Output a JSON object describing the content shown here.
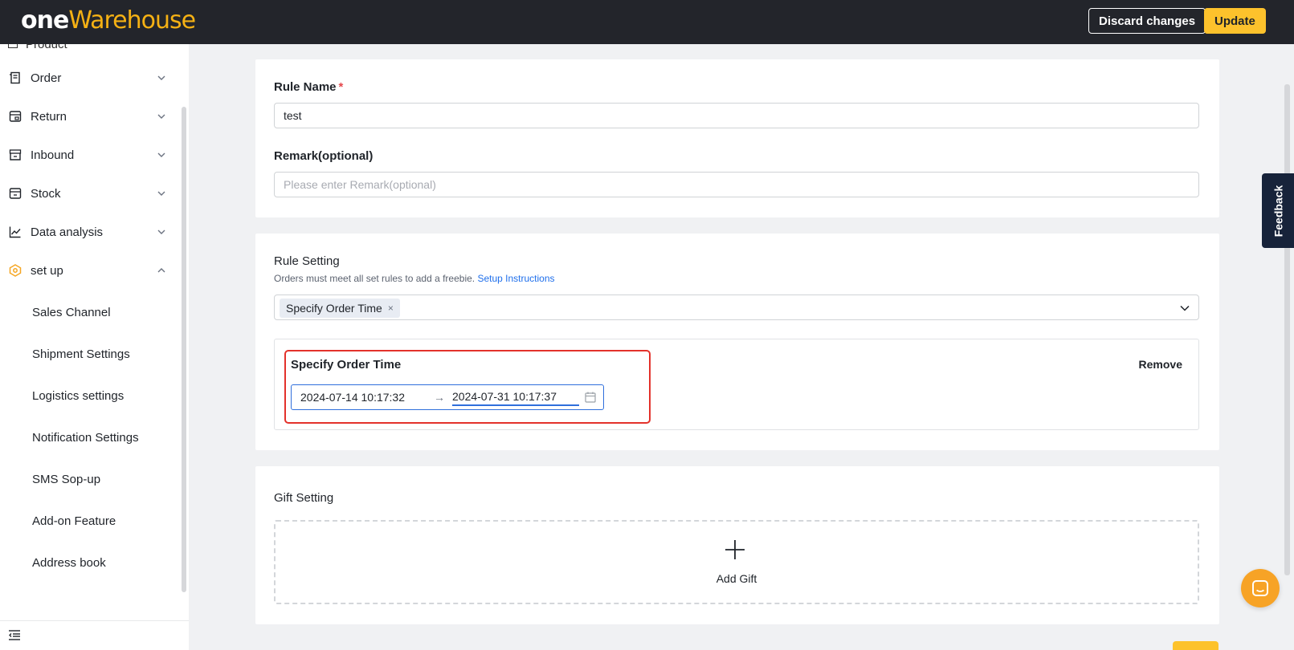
{
  "header": {
    "logo_one": "one",
    "logo_warehouse": "Warehouse",
    "discard_label": "Discard changes",
    "update_label": "Update"
  },
  "sidebar": {
    "partial_item": "Product",
    "items": [
      {
        "label": "Order",
        "icon": "order-icon",
        "expanded": false
      },
      {
        "label": "Return",
        "icon": "return-icon",
        "expanded": false
      },
      {
        "label": "Inbound",
        "icon": "inbound-icon",
        "expanded": false
      },
      {
        "label": "Stock",
        "icon": "stock-icon",
        "expanded": false
      },
      {
        "label": "Data analysis",
        "icon": "data-analysis-icon",
        "expanded": false
      },
      {
        "label": "set up",
        "icon": "setup-icon",
        "expanded": true
      }
    ],
    "sub_items": [
      "Sales Channel",
      "Shipment Settings",
      "Logistics settings",
      "Notification Settings",
      "SMS Sop-up",
      "Add-on Feature",
      "Address book"
    ]
  },
  "basic": {
    "rule_name_label": "Rule Name",
    "required_mark": "*",
    "rule_name_value": "test",
    "remark_label": "Remark(optional)",
    "remark_placeholder": "Please enter Remark(optional)"
  },
  "rule_setting": {
    "title": "Rule Setting",
    "hint": "Orders must meet all set rules to add a freebie.",
    "instructions_link": "Setup Instructions",
    "selected_tag": "Specify Order Time",
    "tag_close": "×",
    "rule_block_title": "Specify Order Time",
    "remove_label": "Remove",
    "start_time": "2024-07-14 10:17:32",
    "range_arrow": "→",
    "end_time": "2024-07-31 10:17:37"
  },
  "gift_setting": {
    "title": "Gift Setting",
    "add_label": "Add Gift"
  },
  "feedback_label": "Feedback",
  "colors": {
    "brand_yellow": "#fdc22c",
    "topbar": "#23252b",
    "highlight_red": "#e3322b",
    "link_blue": "#1f6feb"
  }
}
